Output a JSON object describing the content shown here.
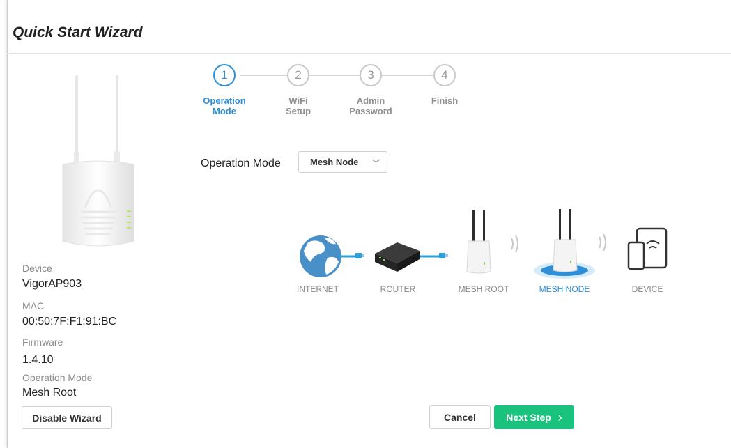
{
  "header": {
    "title": "Quick Start Wizard"
  },
  "device_info": {
    "device_label": "Device",
    "device_value": "VigorAP903",
    "mac_label": "MAC",
    "mac_value": "00:50:7F:F1:91:BC",
    "firmware_label": "Firmware",
    "firmware_value": "1.4.10",
    "opmode_label": "Operation Mode",
    "opmode_value": "Mesh Root"
  },
  "buttons": {
    "disable_wizard": "Disable Wizard",
    "cancel": "Cancel",
    "next_step": "Next Step",
    "next_icon": "›"
  },
  "steps": [
    {
      "number": "1",
      "line1": "Operation",
      "line2": "Mode",
      "active": true
    },
    {
      "number": "2",
      "line1": "WiFi",
      "line2": "Setup",
      "active": false
    },
    {
      "number": "3",
      "line1": "Admin",
      "line2": "Password",
      "active": false
    },
    {
      "number": "4",
      "line1": "Finish",
      "line2": "",
      "active": false
    }
  ],
  "operation_mode": {
    "label": "Operation Mode",
    "selected": "Mesh Node",
    "chevron": "﹀"
  },
  "diagram": {
    "labels": [
      "INTERNET",
      "ROUTER",
      "MESH ROOT",
      "MESH NODE",
      "DEVICE"
    ],
    "active_index": 3
  },
  "colors": {
    "accent": "#2f8fd6",
    "primary_button": "#19c37d",
    "cable": "#2a9fd8"
  }
}
